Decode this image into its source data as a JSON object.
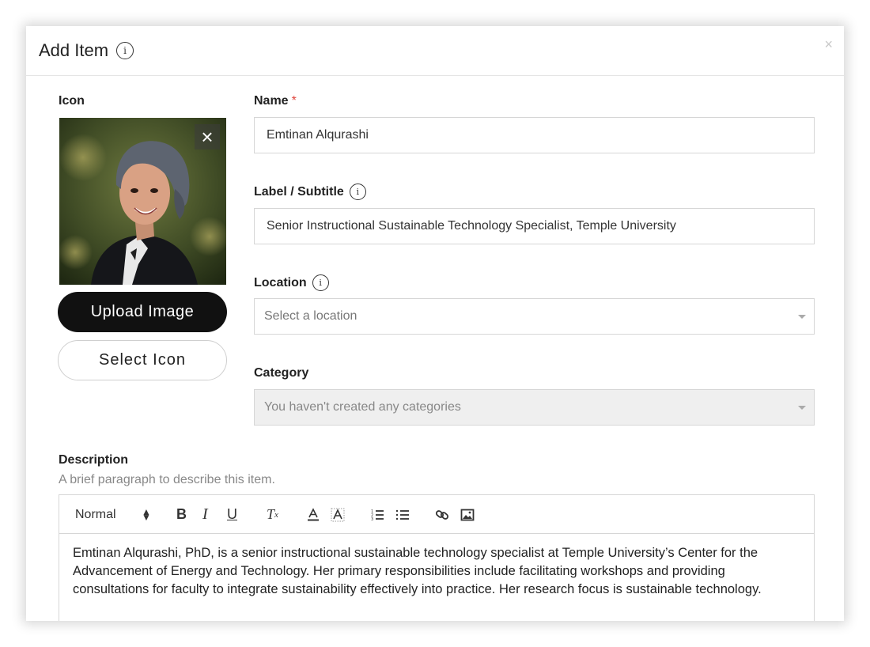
{
  "dialog": {
    "title": "Add Item",
    "close_symbol": "×"
  },
  "icon_section": {
    "label": "Icon",
    "upload_button": "Upload Image",
    "select_button": "Select Icon"
  },
  "fields": {
    "name": {
      "label": "Name",
      "required_mark": "*",
      "value": "Emtinan Alqurashi"
    },
    "subtitle": {
      "label": "Label / Subtitle",
      "value": "Senior Instructional Sustainable Technology Specialist, Temple University"
    },
    "location": {
      "label": "Location",
      "placeholder": "Select a location"
    },
    "category": {
      "label": "Category",
      "placeholder": "You haven't created any categories"
    }
  },
  "description": {
    "label": "Description",
    "help": "A brief paragraph to describe this item.",
    "format_value": "Normal",
    "text": "Emtinan Alqurashi, PhD, is a senior instructional sustainable technology specialist at Temple University’s Center for the Advancement of Energy and Technology. Her primary responsibilities include facilitating workshops and providing consultations for faculty to integrate sustainability effectively into practice. Her research focus is sustainable technology."
  },
  "toolbar_icons": [
    "format-select",
    "bold-icon",
    "italic-icon",
    "underline-icon",
    "clear-format-icon",
    "text-color-icon",
    "background-color-icon",
    "ordered-list-icon",
    "bullet-list-icon",
    "link-icon",
    "image-icon"
  ],
  "colors": {
    "required": "#e0463e",
    "primary_button": "#111111",
    "border": "#d6d6d6",
    "disabled_bg": "#efefef"
  }
}
